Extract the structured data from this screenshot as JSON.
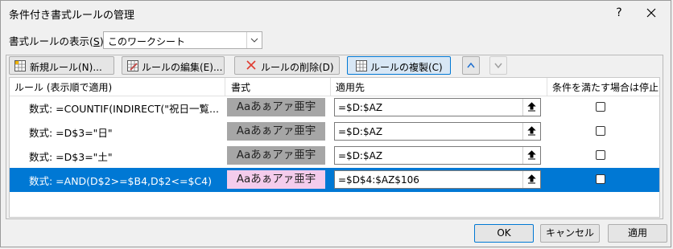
{
  "window": {
    "title": "条件付き書式ルールの管理",
    "help": "?"
  },
  "show": {
    "label": "書式ルールの表示(",
    "accel": "S",
    "label_end": "):",
    "selected": "このワークシート"
  },
  "toolbar": {
    "new_label": "新規ルール(N)...",
    "edit_label": "ルールの編集(E)...",
    "delete_label": "ルールの削除(D)",
    "copy_label": "ルールの複製(C)"
  },
  "columns": {
    "rule": "ルール (表示順で適用)",
    "format": "書式",
    "applies_to": "適用先",
    "stop_if_true": "条件を満たす場合は停止"
  },
  "rules": [
    {
      "rule": "数式: =COUNTIF(INDIRECT(\"祝日一覧...",
      "preview": "Aaあぁアァ亜宇",
      "applies_to": "=$D:$AZ",
      "stop": false,
      "preview_bg": "#a6a6a6"
    },
    {
      "rule": "数式: =D$3=\"日\"",
      "preview": "Aaあぁアァ亜宇",
      "applies_to": "=$D:$AZ",
      "stop": false,
      "preview_bg": "#a6a6a6"
    },
    {
      "rule": "数式: =D$3=\"土\"",
      "preview": "Aaあぁアァ亜宇",
      "applies_to": "=$D:$AZ",
      "stop": false,
      "preview_bg": "#a6a6a6"
    },
    {
      "rule": "数式: =AND(D$2>=$B4,D$2<=$C4)",
      "preview": "Aaあぁアァ亜宇",
      "applies_to": "=$D$4:$AZ$106",
      "stop": false,
      "preview_bg": "#f4ccec",
      "selected": true
    }
  ],
  "footer": {
    "ok": "OK",
    "cancel": "キャンセル",
    "apply": "適用"
  },
  "colors": {
    "selection": "#0078d4",
    "gray_preview": "#a6a6a6",
    "pink_preview": "#f4ccec"
  }
}
